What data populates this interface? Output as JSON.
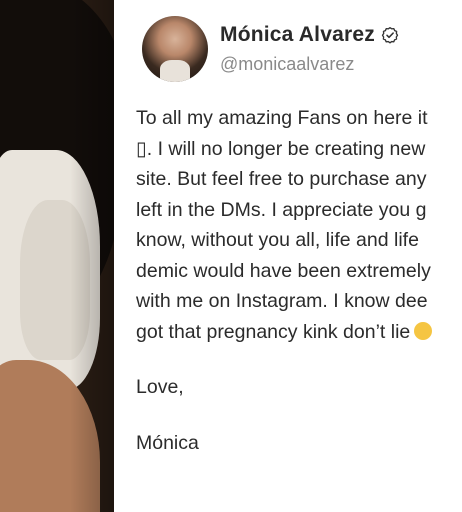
{
  "profile": {
    "display_name": "Mónica Alvarez",
    "handle": "@monicaalvarez",
    "verified_icon": "verified-check-icon"
  },
  "post": {
    "lines": [
      "To all my amazing Fans on here it",
      "▯. I will no longer be creating new",
      "site. But feel free to purchase any",
      "left in the DMs. I appreciate you g",
      "know, without you all, life and life",
      "demic would have been extremely",
      "with me on Instagram. I know dee",
      "got that pregnancy kink don’t lie"
    ],
    "closing": "Love,",
    "signature": "Mónica"
  },
  "colors": {
    "card_background": "#ffffff",
    "name_text": "#2a2a2a",
    "handle_text": "#8a8a8a",
    "body_text": "#2b2b2b"
  }
}
